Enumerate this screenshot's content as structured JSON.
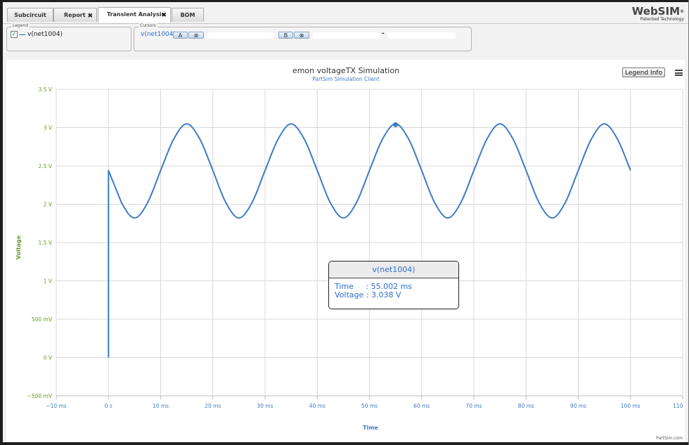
{
  "tabs": [
    {
      "label": "Subcircuit",
      "closable": false,
      "active": false
    },
    {
      "label": "Report",
      "closable": true,
      "active": false
    },
    {
      "label": "Transient Analysis",
      "closable": true,
      "active": true
    },
    {
      "label": "BOM",
      "closable": false,
      "active": false
    }
  ],
  "close_glyph": "✖",
  "logo": {
    "name": "WebSIM",
    "mark": "®",
    "tagline": "Patented Technology"
  },
  "legend_panel": {
    "title": "Legend",
    "checked_mark": "✓",
    "series_label": "v(net1004)"
  },
  "cursors_panel": {
    "title": "Cursors",
    "series_label": "v(net1004)",
    "button_a": "A",
    "button_b": "B",
    "clear_glyph": "⊗",
    "separator": "-"
  },
  "chart_header": {
    "title": "emon voltageTX Simulation",
    "subtitle": "PartSim Simulation Client"
  },
  "legend_info_label": "Legend Info",
  "chart_data": {
    "type": "line",
    "title": "emon voltageTX Simulation",
    "subtitle": "PartSim Simulation Client",
    "xlabel": "Time",
    "ylabel": "Voltage",
    "xlim": [
      -10,
      110
    ],
    "ylim": [
      -0.5,
      3.5
    ],
    "x_ticks": [
      -10,
      0,
      10,
      20,
      30,
      40,
      50,
      60,
      70,
      80,
      90,
      100,
      110
    ],
    "x_tick_labels": [
      "−10 ms",
      "0 s",
      "10 ms",
      "20 ms",
      "30 ms",
      "40 ms",
      "50 ms",
      "60 ms",
      "70 ms",
      "80 ms",
      "90 ms",
      "100 ms",
      "110 ms"
    ],
    "y_ticks": [
      -0.5,
      0,
      0.5,
      1,
      1.5,
      2,
      2.5,
      3,
      3.5
    ],
    "y_tick_labels": [
      "−500 mV",
      "0 V",
      "500 mV",
      "1 V",
      "1.5 V",
      "2 V",
      "2.5 V",
      "3 V",
      "3.5 V"
    ],
    "grid": true,
    "color": "#3d7bc4",
    "series": [
      {
        "name": "v(net1004)",
        "x": [
          0,
          0,
          2.5,
          5,
          7.5,
          10,
          12.5,
          15,
          17.5,
          20,
          22.5,
          25,
          27.5,
          30,
          32.5,
          35,
          37.5,
          40,
          42.5,
          45,
          47.5,
          50,
          52.5,
          55,
          57.5,
          60,
          62.5,
          65,
          67.5,
          70,
          72.5,
          75,
          77.5,
          80,
          82.5,
          85,
          87.5,
          90,
          92.5,
          95,
          97.5,
          100
        ],
        "y": [
          0,
          2.44,
          2.02,
          1.82,
          2.02,
          2.44,
          2.85,
          3.05,
          2.85,
          2.44,
          2.02,
          1.82,
          2.02,
          2.44,
          2.85,
          3.05,
          2.85,
          2.44,
          2.02,
          1.82,
          2.02,
          2.44,
          2.85,
          3.05,
          2.85,
          2.44,
          2.02,
          1.82,
          2.02,
          2.44,
          2.85,
          3.05,
          2.85,
          2.44,
          2.02,
          1.82,
          2.02,
          2.44,
          2.85,
          3.05,
          2.85,
          2.44
        ]
      }
    ],
    "highlight_point": {
      "x": 55.002,
      "y": 3.038
    }
  },
  "tooltip": {
    "title": "v(net1004)",
    "time_line": "Time     : 55.002 ms",
    "voltage_line": "Voltage : 3.038 V"
  },
  "credit": "PartSim.com"
}
